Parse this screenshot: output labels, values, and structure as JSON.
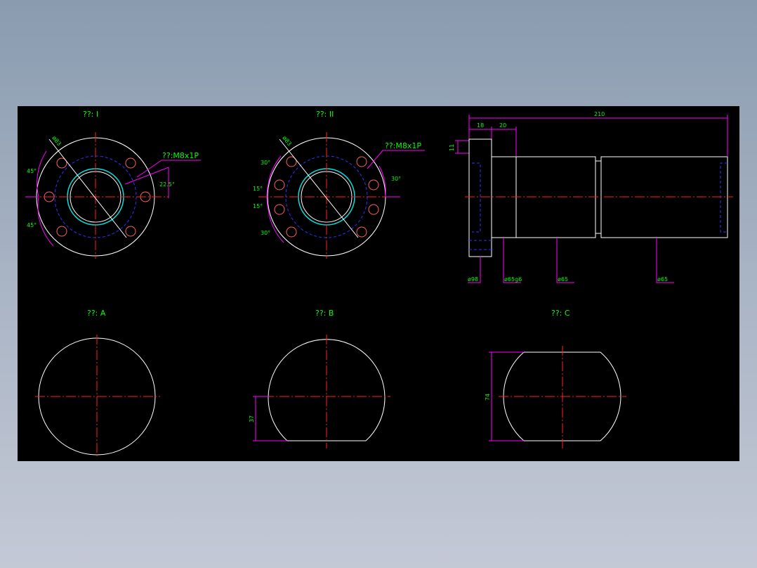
{
  "views": {
    "flange_1": {
      "title": "??: I",
      "callout": "??:M8x1P",
      "dia": "ø83",
      "ang_top": "45°",
      "ang_bot": "45°",
      "ang_right": "22.5°"
    },
    "flange_2": {
      "title": "??: II",
      "callout": "??:M8x1P",
      "dia": "ø83",
      "ang_1": "30°",
      "ang_2": "15°",
      "ang_3": "15°",
      "ang_4": "30°",
      "ang_right": "30°"
    },
    "side": {
      "len_total": "210",
      "len_flange": "18",
      "len_20": "20",
      "h_11": "11",
      "d_flange": "ø98",
      "d_g6": "ø65g6",
      "d_mid": "ø65",
      "d_end": "ø65"
    },
    "section_a": {
      "title": "??: A"
    },
    "section_b": {
      "title": "??: B",
      "dim": "37"
    },
    "section_c": {
      "title": "??: C",
      "dim": "74"
    }
  },
  "colors": {
    "sheet": "#000000",
    "line": "#ffffff",
    "center": "#ff2020",
    "hidden": "#2a2aff",
    "dimension": "#ff00ff",
    "text": "#00ff00",
    "cyan": "#00e0e0",
    "hole": "#ff6060"
  }
}
